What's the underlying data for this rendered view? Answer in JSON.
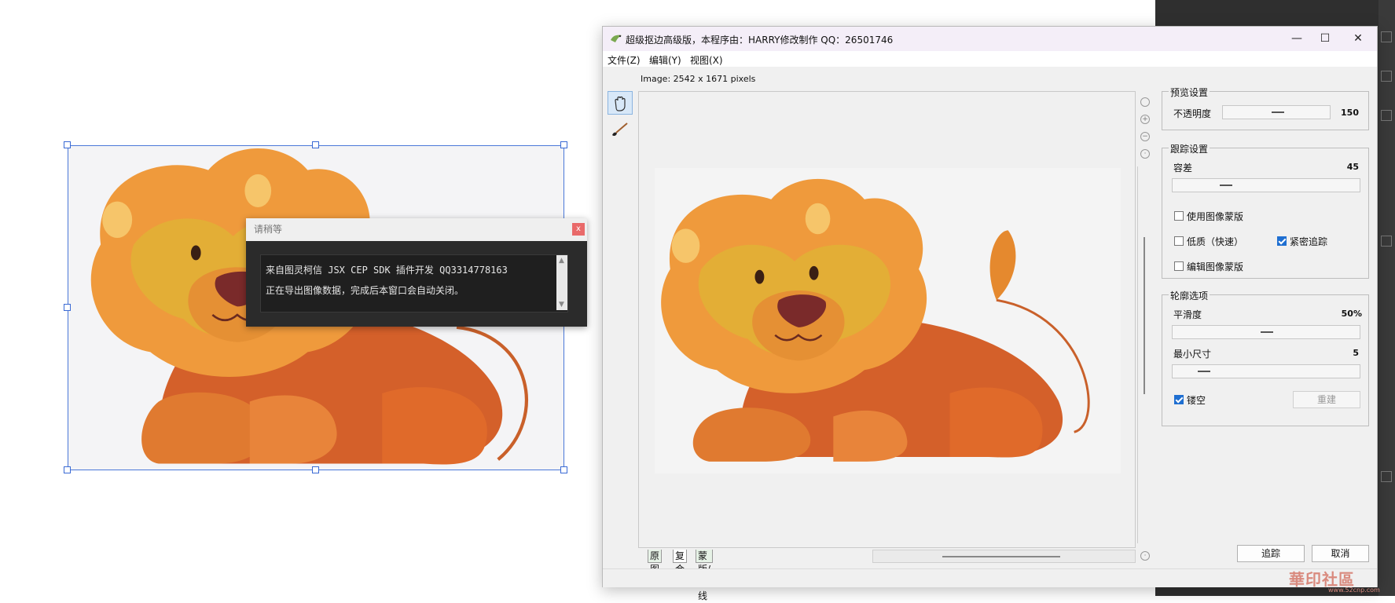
{
  "canvas": {
    "wait_dialog": {
      "title": "请稍等",
      "close_label": "x",
      "line1": "来自图灵柯信 JSX CEP SDK 插件开发 QQ3314778163",
      "line2": "正在导出图像数据，完成后本窗口会自动关闭。"
    }
  },
  "app": {
    "title": "超级抠边高级版，本程序由：HARRY修改制作 QQ：26501746",
    "window_buttons": {
      "minimize": "—",
      "maximize": "☐",
      "close": "✕"
    },
    "menu": [
      "文件(Z)",
      "编辑(Y)",
      "视图(X)"
    ],
    "image_info": "Image: 2542 x 1671 pixels",
    "tabs": [
      "原图",
      "复合",
      "蒙版/曲线"
    ],
    "preview_settings": {
      "title": "预览设置",
      "opacity_label": "不透明度",
      "opacity_value": "150"
    },
    "trace_settings": {
      "title": "跟踪设置",
      "tolerance_label": "容差",
      "tolerance_value": "45",
      "use_image_mask": {
        "label": "使用图像蒙版",
        "checked": false
      },
      "low_quality": {
        "label": "低质（快速）",
        "checked": false
      },
      "tight_trace": {
        "label": "紧密追踪",
        "checked": true
      },
      "edit_image_mask": {
        "label": "编辑图像蒙版",
        "checked": false
      }
    },
    "contour_options": {
      "title": "轮廓选项",
      "smoothness_label": "平滑度",
      "smoothness_value": "50%",
      "min_size_label": "最小尺寸",
      "min_size_value": "5",
      "hollow": {
        "label": "镂空",
        "checked": true
      },
      "rebuild_label": "重建"
    },
    "actions": {
      "trace_label": "追踪",
      "cancel_label": "取消"
    }
  },
  "watermark": {
    "text": "華印社區",
    "sub": "www.52cnp.com"
  },
  "colors": {
    "selection": "#4a78d8",
    "lion_body": "#e8822e",
    "lion_mane": "#f0a040",
    "lion_face": "#e3ae36",
    "lion_nose": "#7a2a2a",
    "checkbox_checked": "#1f6fd1"
  }
}
